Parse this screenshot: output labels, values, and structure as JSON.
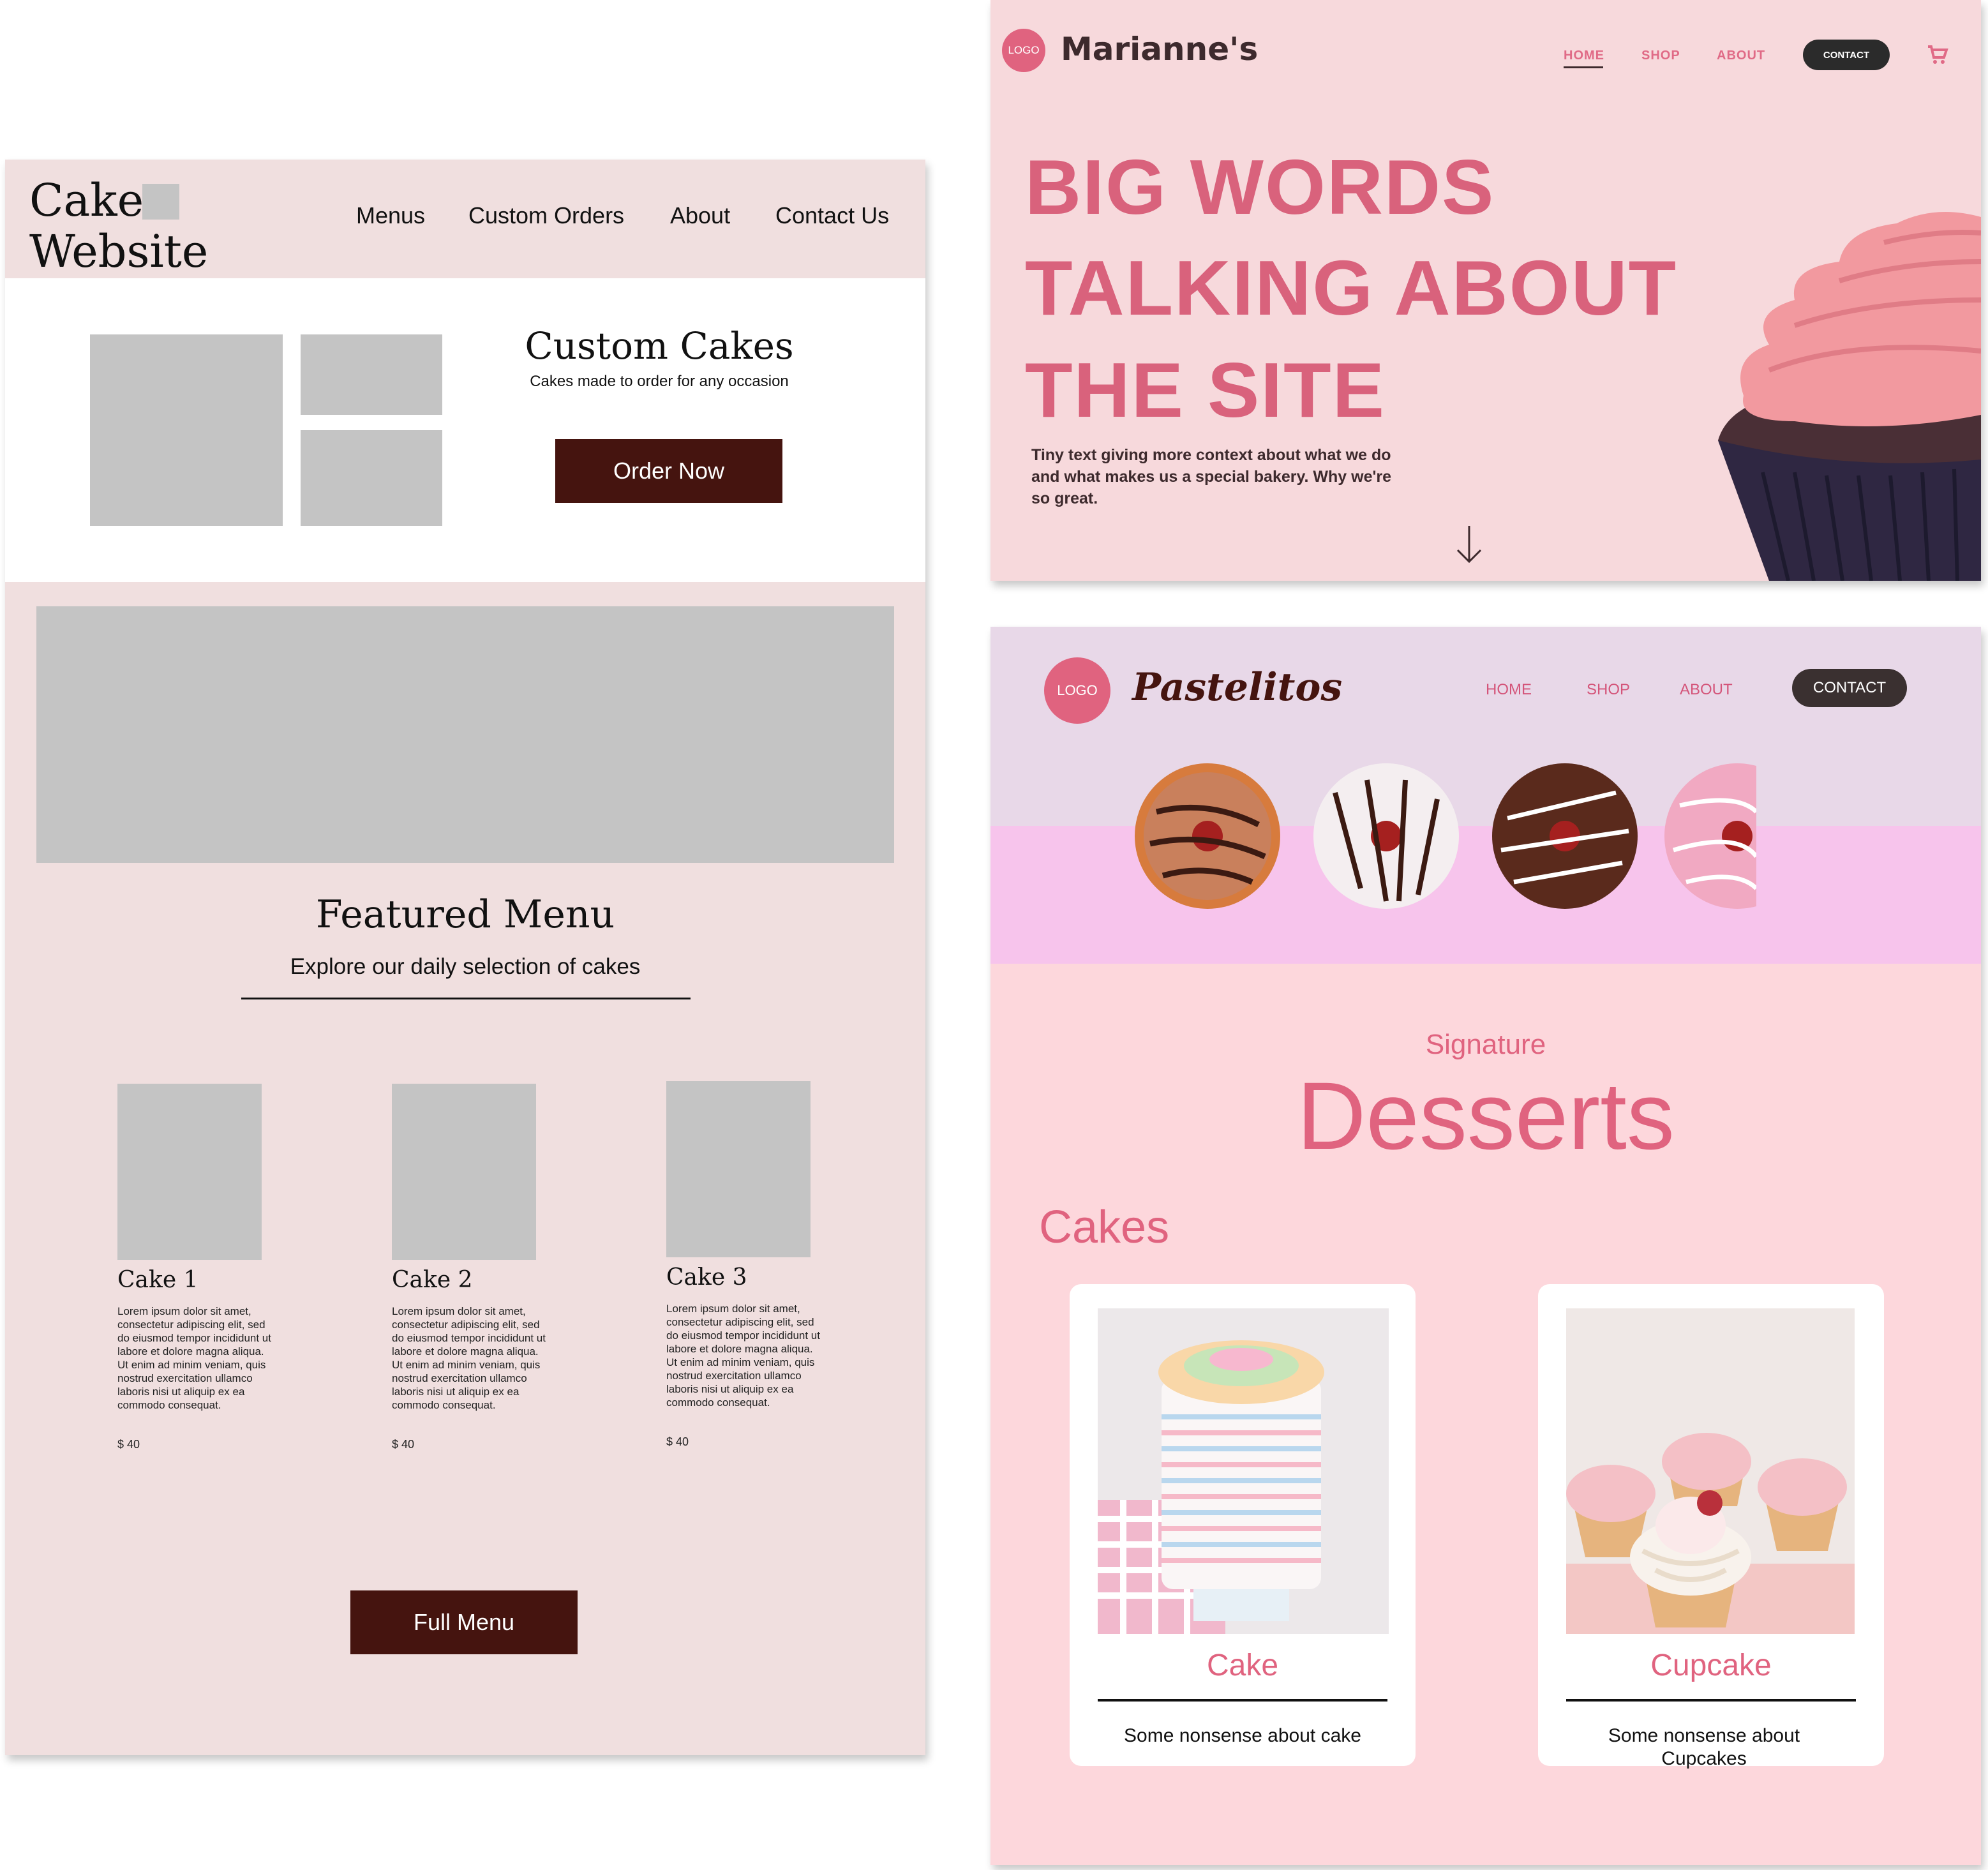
{
  "wireframe": {
    "logo_line1": "Cake",
    "logo_line2": "Website",
    "nav": [
      "Menus",
      "Custom Orders",
      "About",
      "Contact Us"
    ],
    "custom_title": "Custom Cakes",
    "custom_subtitle": "Cakes made to order for any occasion",
    "order_button": "Order Now",
    "featured_title": "Featured Menu",
    "featured_subtitle": "Explore our daily selection of cakes",
    "cakes": [
      {
        "name": "Cake 1",
        "desc": "Lorem ipsum dolor sit amet, consectetur adipiscing elit, sed do eiusmod tempor incididunt ut labore et dolore magna aliqua. Ut enim ad minim veniam, quis nostrud exercitation ullamco laboris nisi ut aliquip ex ea commodo consequat.",
        "price": "$ 40"
      },
      {
        "name": "Cake 2",
        "desc": "Lorem ipsum dolor sit amet, consectetur adipiscing elit, sed do eiusmod tempor incididunt ut labore et dolore magna aliqua. Ut enim ad minim veniam, quis nostrud exercitation ullamco laboris nisi ut aliquip ex ea commodo consequat.",
        "price": "$ 40"
      },
      {
        "name": "Cake 3",
        "desc": "Lorem ipsum dolor sit amet, consectetur adipiscing elit, sed do eiusmod tempor incididunt ut labore et dolore magna aliqua. Ut enim ad minim veniam, quis nostrud exercitation ullamco laboris nisi ut aliquip ex ea commodo consequat.",
        "price": "$ 40"
      }
    ],
    "full_menu_button": "Full Menu"
  },
  "mariannes": {
    "logo": "LOGO",
    "brand": "Marianne's",
    "nav": [
      "HOME",
      "SHOP",
      "ABOUT"
    ],
    "contact": "CONTACT",
    "cart_icon": "cart-icon",
    "headline": [
      "BIG WORDS",
      "TALKING ABOUT",
      "THE SITE"
    ],
    "body": "Tiny text giving more context about what we do and what makes us a special bakery. Why we're so great.",
    "arrow_icon": "arrow-down-icon"
  },
  "pastelitos": {
    "logo": "LOGO",
    "brand": "Pastelitos",
    "nav": [
      "HOME",
      "SHOP",
      "ABOUT"
    ],
    "contact": "CONTACT",
    "signature": "Signature",
    "desserts": "Desserts",
    "section": "Cakes",
    "cards": [
      {
        "title": "Cake",
        "desc": "Some nonsense about cake"
      },
      {
        "title": "Cupcake",
        "desc": "Some nonsense about Cupcakes"
      }
    ]
  },
  "colors": {
    "wireframe_bg": "#f0dfdf",
    "button_dark": "#45140f",
    "accent_pink": "#e0637f",
    "headline_pink": "#d9627c"
  }
}
